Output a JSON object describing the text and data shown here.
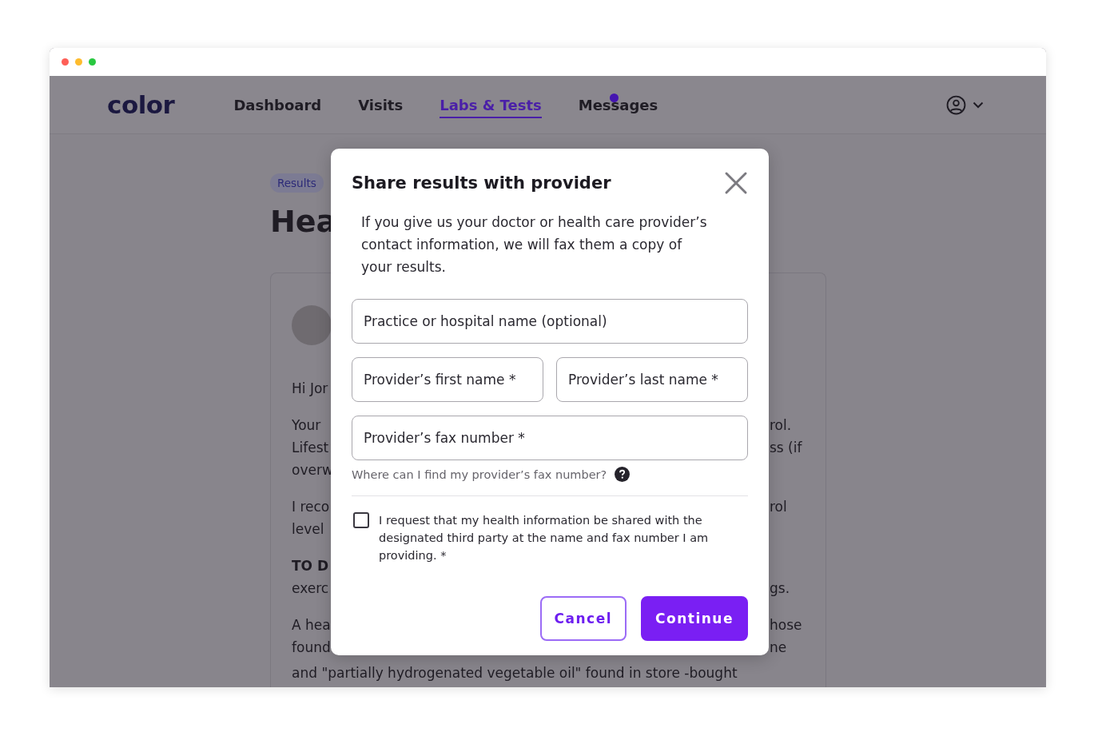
{
  "app": {
    "logo": "color",
    "nav": [
      {
        "label": "Dashboard",
        "selected": false,
        "unread": false
      },
      {
        "label": "Visits",
        "selected": false,
        "unread": false
      },
      {
        "label": "Labs & Tests",
        "selected": true,
        "unread": false
      },
      {
        "label": "Messages",
        "selected": false,
        "unread": true
      }
    ]
  },
  "article": {
    "breadcrumb": "Results",
    "heading": "Hea",
    "paragraphs": [
      {
        "lines": [
          {
            "left": "Hi Jor",
            "bold": false
          }
        ]
      },
      {
        "lines": [
          {
            "left": "Your",
            "right": "rol.",
            "bold": false
          },
          {
            "left": "Lifest",
            "right": "ss (if",
            "bold": false
          },
          {
            "left": "overw",
            "bold": false
          }
        ]
      },
      {
        "lines": [
          {
            "left": "I reco",
            "right": "rol",
            "bold": false
          },
          {
            "left": "level",
            "bold": false
          }
        ]
      },
      {
        "lines": [
          {
            "left": "TO D",
            "bold": true
          },
          {
            "left": "exerc",
            "right": "gs.",
            "bold": false
          }
        ]
      },
      {
        "lines": [
          {
            "left": "A hea",
            "right": "hose",
            "bold": false
          },
          {
            "left": "found",
            "right": "ne",
            "bold": false
          },
          {
            "left": "and \"partially hydrogenated vegetable oil\" found in store -bought",
            "bold": false
          }
        ]
      }
    ]
  },
  "dialog": {
    "title": "Share results with provider",
    "description": "If you give us your doctor or health care provider’s contact information, we will fax them a copy of your results.",
    "field_rows": [
      [
        {
          "placeholder": "Practice or hospital name (optional)"
        }
      ],
      [
        {
          "placeholder": "Provider’s first name *"
        },
        {
          "placeholder": "Provider’s last name *"
        }
      ],
      [
        {
          "placeholder": "Provider’s fax number *"
        }
      ]
    ],
    "help_text": "Where can I find my provider’s fax number?",
    "consent": {
      "label": "I request that my health information be shared with the designated third party at the name and fax number I am providing. *",
      "checked": false
    },
    "buttons": [
      {
        "label": "Cancel",
        "kind": "secondary"
      },
      {
        "label": "Continue",
        "kind": "primary"
      }
    ]
  }
}
